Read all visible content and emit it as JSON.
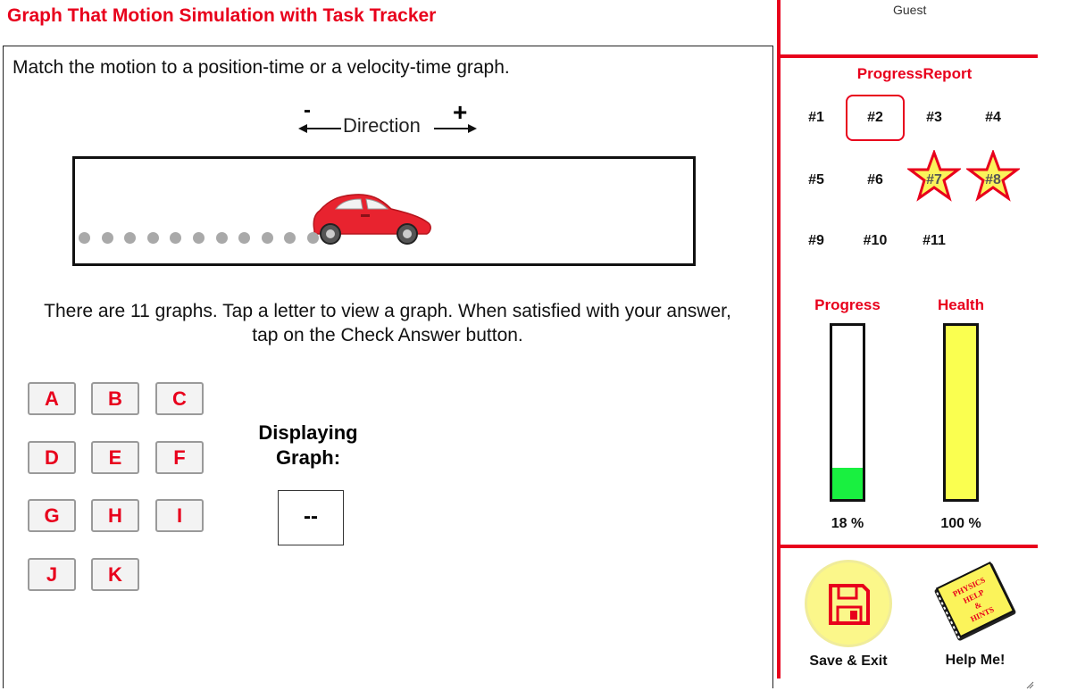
{
  "app": {
    "title": "Graph That Motion Simulation with Task Tracker"
  },
  "main": {
    "instruction": "Match the motion to a position-time or a velocity-time graph.",
    "direction": {
      "label": "Direction",
      "minus": "-",
      "plus": "+"
    },
    "tap_text": "There are 11 graphs. Tap a letter to view a graph. When satisfied with your answer, tap on the Check Answer button.",
    "letters": [
      "A",
      "B",
      "C",
      "D",
      "E",
      "F",
      "G",
      "H",
      "I",
      "J",
      "K"
    ],
    "displaying_label": "Displaying Graph:",
    "displaying_value": "--"
  },
  "sidebar": {
    "user": "Guest",
    "progress_report_title": "ProgressReport",
    "tasks": [
      {
        "label": "#1",
        "state": "normal"
      },
      {
        "label": "#2",
        "state": "current"
      },
      {
        "label": "#3",
        "state": "normal"
      },
      {
        "label": "#4",
        "state": "normal"
      },
      {
        "label": "#5",
        "state": "normal"
      },
      {
        "label": "#6",
        "state": "normal"
      },
      {
        "label": "#7",
        "state": "star"
      },
      {
        "label": "#8",
        "state": "star"
      },
      {
        "label": "#9",
        "state": "normal"
      },
      {
        "label": "#10",
        "state": "normal"
      },
      {
        "label": "#11",
        "state": "normal"
      }
    ],
    "progress": {
      "label": "Progress",
      "value_text": "18 %",
      "fraction": 0.18,
      "color": "#19f040"
    },
    "health": {
      "label": "Health",
      "value_text": "100 %",
      "fraction": 1.0,
      "color": "#faff50"
    },
    "save_label": "Save & Exit",
    "help_label": "Help Me!",
    "help_book_text": [
      "PHYSICS",
      "HELP",
      "&",
      "HINTS"
    ]
  },
  "colors": {
    "accent": "#e8001c",
    "car": "#e8232f",
    "track_dots": "#a9a9a9"
  },
  "icons": {
    "save": "floppy-disk-icon",
    "help": "physics-help-book-icon",
    "star": "star-icon",
    "car": "car-icon"
  }
}
